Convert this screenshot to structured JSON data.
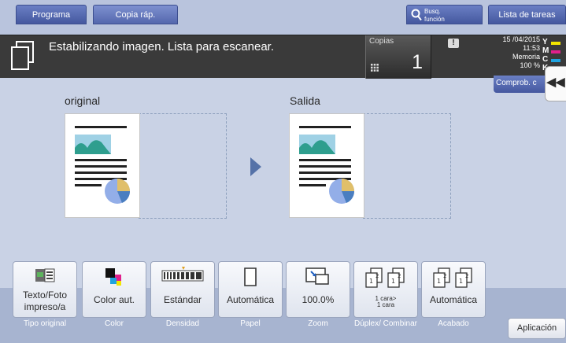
{
  "topbar": {
    "program_tab": "Programa",
    "quick_copy_tab": "Copia ráp.",
    "search_function_line1": "Busq.",
    "search_function_line2": "función",
    "job_list_button": "Lista de tareas"
  },
  "status": {
    "message": "Estabilizando imagen. Lista para escanear.",
    "copies_label": "Copias",
    "copies_value": "1",
    "date": "15 /04/2015",
    "time": "11:53",
    "memory_label": "Memoria",
    "memory_value": "100 %",
    "toner": [
      {
        "letter": "Y",
        "color": "#f2e600"
      },
      {
        "letter": "M",
        "color": "#e0208c"
      },
      {
        "letter": "C",
        "color": "#1fa3e0"
      },
      {
        "letter": "K",
        "color": "#222222"
      }
    ],
    "check_tab": "Comprob. c"
  },
  "preview": {
    "original_label": "original",
    "output_label": "Salida"
  },
  "functions": [
    {
      "id": "original-type",
      "label": "Texto/Foto impreso/a",
      "caption": "Tipo original",
      "icon": "original-type-icon"
    },
    {
      "id": "color",
      "label": "Color aut.",
      "caption": "Color",
      "icon": "color-icon"
    },
    {
      "id": "density",
      "label": "Estándar",
      "caption": "Densidad",
      "icon": "density-icon"
    },
    {
      "id": "paper",
      "label": "Automática",
      "caption": "Papel",
      "icon": "paper-icon"
    },
    {
      "id": "zoom",
      "label": "100.0%",
      "caption": "Zoom",
      "icon": "zoom-icon"
    },
    {
      "id": "duplex",
      "label_line1": "1 cara>",
      "label_line2": "1 cara",
      "caption": "Dúplex/ Combinar",
      "icon": "duplex-icon"
    },
    {
      "id": "finishing",
      "label": "Automática",
      "caption": "Acabado",
      "icon": "finishing-icon"
    }
  ],
  "application_button": "Aplicación",
  "colors": {
    "accent": "#45589f",
    "background": "#c9d2e5",
    "status_bar": "#3a3a3a"
  }
}
